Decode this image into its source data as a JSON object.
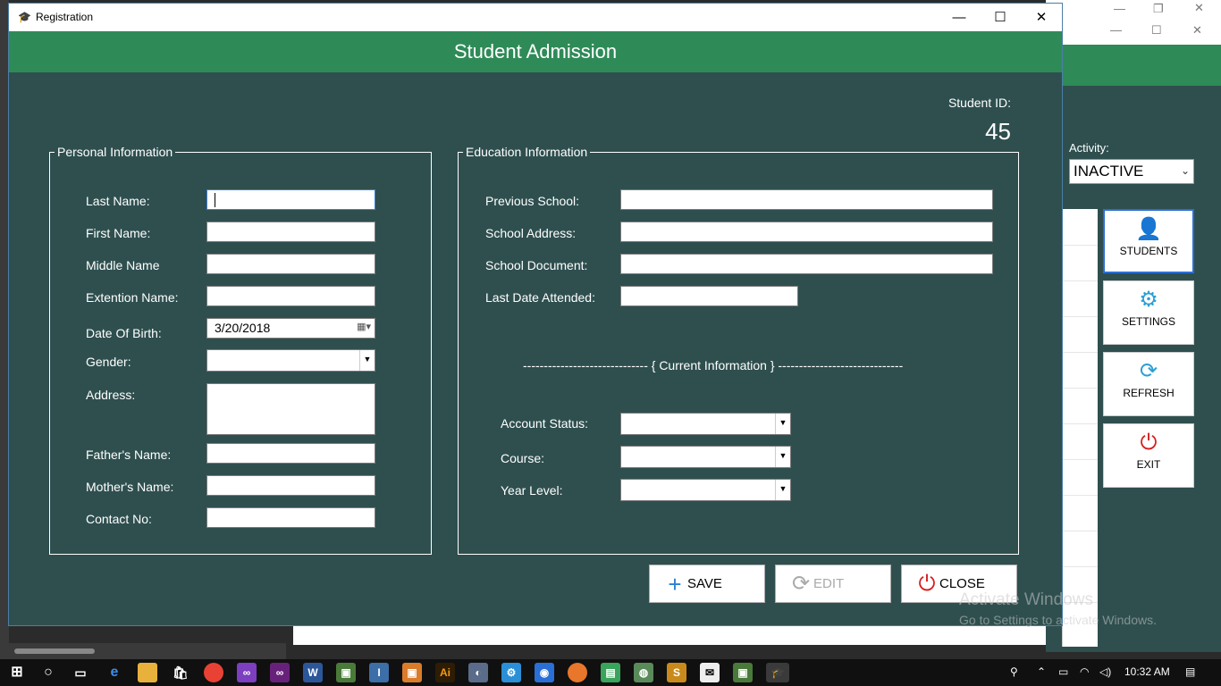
{
  "window": {
    "title": "Registration",
    "icon": "graduation-cap-icon",
    "minimize": "—",
    "maximize": "☐",
    "close": "✕"
  },
  "header": {
    "title": "Student Admission"
  },
  "student_id": {
    "label": "Student ID:",
    "value": "45"
  },
  "personal": {
    "legend": "Personal Information",
    "last_name": {
      "label": "Last Name:",
      "value": ""
    },
    "first_name": {
      "label": "First Name:",
      "value": ""
    },
    "middle_name": {
      "label": "Middle Name",
      "value": ""
    },
    "extension_name": {
      "label": "Extention Name:",
      "value": ""
    },
    "dob": {
      "label": "Date Of Birth:",
      "value": "3/20/2018"
    },
    "gender": {
      "label": "Gender:",
      "value": ""
    },
    "address": {
      "label": "Address:",
      "value": ""
    },
    "father": {
      "label": "Father's Name:",
      "value": ""
    },
    "mother": {
      "label": "Mother's Name:",
      "value": ""
    },
    "contact": {
      "label": "Contact No:",
      "value": ""
    }
  },
  "education": {
    "legend": "Education Information",
    "prev_school": {
      "label": "Previous School:",
      "value": ""
    },
    "school_address": {
      "label": "School Address:",
      "value": ""
    },
    "school_document": {
      "label": "School Document:",
      "value": ""
    },
    "last_attended": {
      "label": "Last Date Attended:",
      "value": ""
    },
    "current_divider": "------------------------------ { Current Information } ------------------------------",
    "account_status": {
      "label": "Account Status:",
      "value": ""
    },
    "course": {
      "label": "Course:",
      "value": ""
    },
    "year_level": {
      "label": "Year Level:",
      "value": ""
    }
  },
  "buttons": {
    "save": "SAVE",
    "edit": "EDIT",
    "close": "CLOSE"
  },
  "background_app": {
    "activity_label": "Activity:",
    "activity_value": "INACTIVE",
    "side_buttons": {
      "students": "STUDENTS",
      "settings": "SETTINGS",
      "refresh": "REFRESH",
      "exit": "EXIT"
    }
  },
  "watermark": {
    "line1": "Activate Windows",
    "line2": "Go to Settings to activate Windows."
  },
  "taskbar": {
    "time": "10:32 AM"
  },
  "colors": {
    "header_green": "#2e8b57",
    "panel": "#2f4f4f",
    "accent_blue": "#2a6fd6"
  }
}
